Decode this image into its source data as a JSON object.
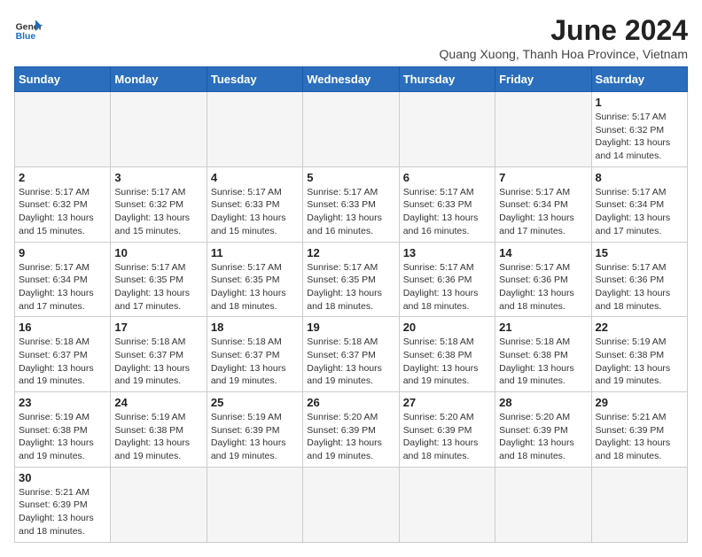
{
  "logo": {
    "line1": "General",
    "line2": "Blue"
  },
  "title": "June 2024",
  "subtitle": "Quang Xuong, Thanh Hoa Province, Vietnam",
  "weekdays": [
    "Sunday",
    "Monday",
    "Tuesday",
    "Wednesday",
    "Thursday",
    "Friday",
    "Saturday"
  ],
  "weeks": [
    [
      {
        "day": "",
        "info": ""
      },
      {
        "day": "",
        "info": ""
      },
      {
        "day": "",
        "info": ""
      },
      {
        "day": "",
        "info": ""
      },
      {
        "day": "",
        "info": ""
      },
      {
        "day": "",
        "info": ""
      },
      {
        "day": "1",
        "info": "Sunrise: 5:17 AM\nSunset: 6:32 PM\nDaylight: 13 hours and 14 minutes."
      }
    ],
    [
      {
        "day": "2",
        "info": "Sunrise: 5:17 AM\nSunset: 6:32 PM\nDaylight: 13 hours and 15 minutes."
      },
      {
        "day": "3",
        "info": "Sunrise: 5:17 AM\nSunset: 6:32 PM\nDaylight: 13 hours and 15 minutes."
      },
      {
        "day": "4",
        "info": "Sunrise: 5:17 AM\nSunset: 6:33 PM\nDaylight: 13 hours and 15 minutes."
      },
      {
        "day": "5",
        "info": "Sunrise: 5:17 AM\nSunset: 6:33 PM\nDaylight: 13 hours and 16 minutes."
      },
      {
        "day": "6",
        "info": "Sunrise: 5:17 AM\nSunset: 6:33 PM\nDaylight: 13 hours and 16 minutes."
      },
      {
        "day": "7",
        "info": "Sunrise: 5:17 AM\nSunset: 6:34 PM\nDaylight: 13 hours and 17 minutes."
      },
      {
        "day": "8",
        "info": "Sunrise: 5:17 AM\nSunset: 6:34 PM\nDaylight: 13 hours and 17 minutes."
      }
    ],
    [
      {
        "day": "9",
        "info": "Sunrise: 5:17 AM\nSunset: 6:34 PM\nDaylight: 13 hours and 17 minutes."
      },
      {
        "day": "10",
        "info": "Sunrise: 5:17 AM\nSunset: 6:35 PM\nDaylight: 13 hours and 17 minutes."
      },
      {
        "day": "11",
        "info": "Sunrise: 5:17 AM\nSunset: 6:35 PM\nDaylight: 13 hours and 18 minutes."
      },
      {
        "day": "12",
        "info": "Sunrise: 5:17 AM\nSunset: 6:35 PM\nDaylight: 13 hours and 18 minutes."
      },
      {
        "day": "13",
        "info": "Sunrise: 5:17 AM\nSunset: 6:36 PM\nDaylight: 13 hours and 18 minutes."
      },
      {
        "day": "14",
        "info": "Sunrise: 5:17 AM\nSunset: 6:36 PM\nDaylight: 13 hours and 18 minutes."
      },
      {
        "day": "15",
        "info": "Sunrise: 5:17 AM\nSunset: 6:36 PM\nDaylight: 13 hours and 18 minutes."
      }
    ],
    [
      {
        "day": "16",
        "info": "Sunrise: 5:18 AM\nSunset: 6:37 PM\nDaylight: 13 hours and 19 minutes."
      },
      {
        "day": "17",
        "info": "Sunrise: 5:18 AM\nSunset: 6:37 PM\nDaylight: 13 hours and 19 minutes."
      },
      {
        "day": "18",
        "info": "Sunrise: 5:18 AM\nSunset: 6:37 PM\nDaylight: 13 hours and 19 minutes."
      },
      {
        "day": "19",
        "info": "Sunrise: 5:18 AM\nSunset: 6:37 PM\nDaylight: 13 hours and 19 minutes."
      },
      {
        "day": "20",
        "info": "Sunrise: 5:18 AM\nSunset: 6:38 PM\nDaylight: 13 hours and 19 minutes."
      },
      {
        "day": "21",
        "info": "Sunrise: 5:18 AM\nSunset: 6:38 PM\nDaylight: 13 hours and 19 minutes."
      },
      {
        "day": "22",
        "info": "Sunrise: 5:19 AM\nSunset: 6:38 PM\nDaylight: 13 hours and 19 minutes."
      }
    ],
    [
      {
        "day": "23",
        "info": "Sunrise: 5:19 AM\nSunset: 6:38 PM\nDaylight: 13 hours and 19 minutes."
      },
      {
        "day": "24",
        "info": "Sunrise: 5:19 AM\nSunset: 6:38 PM\nDaylight: 13 hours and 19 minutes."
      },
      {
        "day": "25",
        "info": "Sunrise: 5:19 AM\nSunset: 6:39 PM\nDaylight: 13 hours and 19 minutes."
      },
      {
        "day": "26",
        "info": "Sunrise: 5:20 AM\nSunset: 6:39 PM\nDaylight: 13 hours and 19 minutes."
      },
      {
        "day": "27",
        "info": "Sunrise: 5:20 AM\nSunset: 6:39 PM\nDaylight: 13 hours and 18 minutes."
      },
      {
        "day": "28",
        "info": "Sunrise: 5:20 AM\nSunset: 6:39 PM\nDaylight: 13 hours and 18 minutes."
      },
      {
        "day": "29",
        "info": "Sunrise: 5:21 AM\nSunset: 6:39 PM\nDaylight: 13 hours and 18 minutes."
      }
    ],
    [
      {
        "day": "30",
        "info": "Sunrise: 5:21 AM\nSunset: 6:39 PM\nDaylight: 13 hours and 18 minutes."
      },
      {
        "day": "",
        "info": ""
      },
      {
        "day": "",
        "info": ""
      },
      {
        "day": "",
        "info": ""
      },
      {
        "day": "",
        "info": ""
      },
      {
        "day": "",
        "info": ""
      },
      {
        "day": "",
        "info": ""
      }
    ]
  ]
}
